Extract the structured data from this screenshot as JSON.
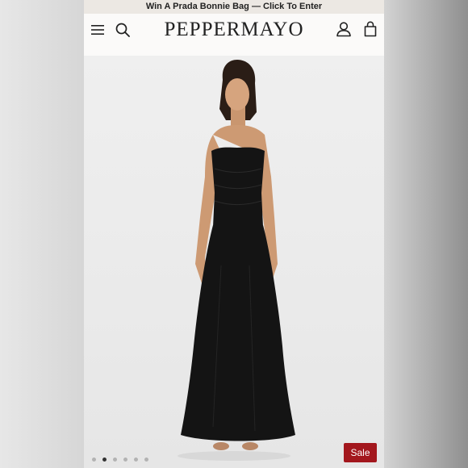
{
  "promo": {
    "text": "Win A Prada Bonnie Bag — Click To Enter"
  },
  "header": {
    "brand": "PEPPERMAYO",
    "icons": [
      "menu-icon",
      "search-icon",
      "account-icon",
      "bag-icon"
    ]
  },
  "product": {
    "image_alt": "Model wearing black strapless maxi dress",
    "dress_color": "#141414",
    "background_color": "#ededed"
  },
  "carousel": {
    "total": 6,
    "active_index": 1
  },
  "badge": {
    "label": "Sale",
    "color": "#a3171d"
  }
}
